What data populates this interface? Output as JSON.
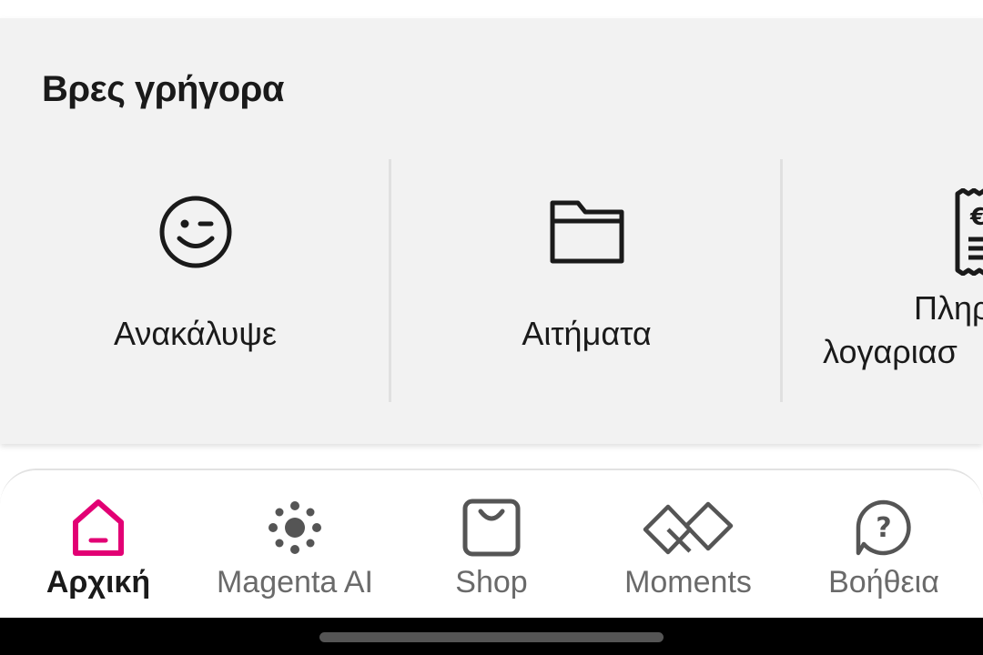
{
  "quick_find": {
    "title": "Βρες γρήγορα",
    "tiles": [
      {
        "label": "Ανακάλυψε",
        "icon": "wink-smiley-icon"
      },
      {
        "label": "Αιτήματα",
        "icon": "folder-icon"
      },
      {
        "label_line1": "Πληρ",
        "label_line2": "λογαριασ",
        "icon": "euro-receipt-icon"
      }
    ]
  },
  "bottom_nav": {
    "active_color": "#e20074",
    "items": [
      {
        "label": "Αρχική",
        "icon": "home-icon",
        "active": true
      },
      {
        "label": "Magenta AI",
        "icon": "magenta-ai-icon",
        "active": false
      },
      {
        "label": "Shop",
        "icon": "shopping-bag-icon",
        "active": false
      },
      {
        "label": "Moments",
        "icon": "moments-icon",
        "active": false
      },
      {
        "label": "Βοήθεια",
        "icon": "help-icon",
        "active": false
      }
    ]
  }
}
